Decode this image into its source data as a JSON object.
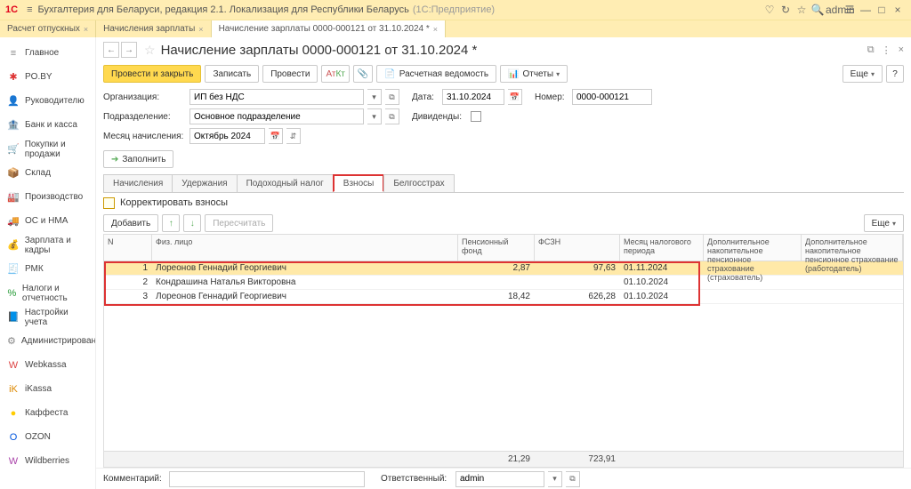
{
  "title": {
    "logo": "1C",
    "burger": "≡",
    "main": "Бухгалтерия для Беларуси, редакция 2.1. Локализация для Республики Беларусь",
    "sub": "(1С:Предприятие)",
    "user": "admin"
  },
  "wtabs": [
    {
      "label": "Расчет отпускных",
      "close": "×"
    },
    {
      "label": "Начисления зарплаты",
      "close": "×"
    },
    {
      "label": "Начисление зарплаты 0000-000121 от 31.10.2024 *",
      "close": "×",
      "active": true
    }
  ],
  "sidebar": [
    {
      "icon": "≡",
      "label": "Главное",
      "color": "#888"
    },
    {
      "icon": "✱",
      "label": "PO.BY",
      "color": "#d33"
    },
    {
      "icon": "👤",
      "label": "Руководителю",
      "color": "#888"
    },
    {
      "icon": "🏦",
      "label": "Банк и касса",
      "color": "#090"
    },
    {
      "icon": "🛒",
      "label": "Покупки и продажи",
      "color": "#a00"
    },
    {
      "icon": "📦",
      "label": "Склад",
      "color": "#a33"
    },
    {
      "icon": "🏭",
      "label": "Производство",
      "color": "#666"
    },
    {
      "icon": "🚚",
      "label": "ОС и НМА",
      "color": "#666"
    },
    {
      "icon": "💰",
      "label": "Зарплата и кадры",
      "color": "#c80"
    },
    {
      "icon": "🧾",
      "label": "РМК",
      "color": "#a55"
    },
    {
      "icon": "%",
      "label": "Налоги и отчетность",
      "color": "#293"
    },
    {
      "icon": "📘",
      "label": "Настройки учета",
      "color": "#357"
    },
    {
      "icon": "⚙",
      "label": "Администрирование",
      "color": "#888"
    },
    {
      "icon": "W",
      "label": "Webkassa",
      "color": "#d44"
    },
    {
      "icon": "iK",
      "label": "iKassa",
      "color": "#d80"
    },
    {
      "icon": "●",
      "label": "Каффеста",
      "color": "#fc0"
    },
    {
      "icon": "O",
      "label": "OZON",
      "color": "#05d"
    },
    {
      "icon": "W",
      "label": "Wildberries",
      "color": "#a4a"
    }
  ],
  "doc": {
    "title": "Начисление зарплаты 0000-000121 от 31.10.2024 *"
  },
  "toolbar": {
    "post_close": "Провести и закрыть",
    "write": "Записать",
    "post": "Провести",
    "vedomost": "Расчетная ведомость",
    "reports": "Отчеты",
    "more": "Еще",
    "help": "?"
  },
  "fields": {
    "org_label": "Организация:",
    "org_value": "ИП без НДС",
    "date_label": "Дата:",
    "date_value": "31.10.2024",
    "num_label": "Номер:",
    "num_value": "0000-000121",
    "dept_label": "Подразделение:",
    "dept_value": "Основное подразделение",
    "div_label": "Дивиденды:",
    "mon_label": "Месяц начисления:",
    "mon_value": "Октябрь 2024",
    "fill": "Заполнить"
  },
  "subtabs": [
    {
      "label": "Начисления"
    },
    {
      "label": "Удержания"
    },
    {
      "label": "Подоходный налог"
    },
    {
      "label": "Взносы",
      "active": true
    },
    {
      "label": "Белгосстрах"
    }
  ],
  "grid": {
    "corr": "Корректировать взносы",
    "add": "Добавить",
    "recalc": "Пересчитать",
    "more": "Еще",
    "head": {
      "n": "N",
      "fio": "Физ. лицо",
      "pf": "Пенсионный фонд",
      "fszn": "ФСЗН",
      "per": "Месяц налогового периода",
      "d1": "Дополнительное накопительное пенсионное страхование (страхователь)",
      "d2": "Дополнительное накопительное пенсионное страхование (работодатель)"
    },
    "rows": [
      {
        "n": "1",
        "fio": "Лореонов Геннадий Георгиевич",
        "pf": "2,87",
        "fszn": "97,63",
        "per": "01.11.2024",
        "sel": true
      },
      {
        "n": "2",
        "fio": "Кондрашина Наталья Викторовна",
        "pf": "",
        "fszn": "",
        "per": "01.10.2024"
      },
      {
        "n": "3",
        "fio": "Лореонов Геннадий Георгиевич",
        "pf": "18,42",
        "fszn": "626,28",
        "per": "01.10.2024"
      }
    ],
    "totals": {
      "pf": "21,29",
      "fszn": "723,91"
    }
  },
  "footer": {
    "comment_label": "Комментарий:",
    "resp_label": "Ответственный:",
    "resp_value": "admin"
  }
}
